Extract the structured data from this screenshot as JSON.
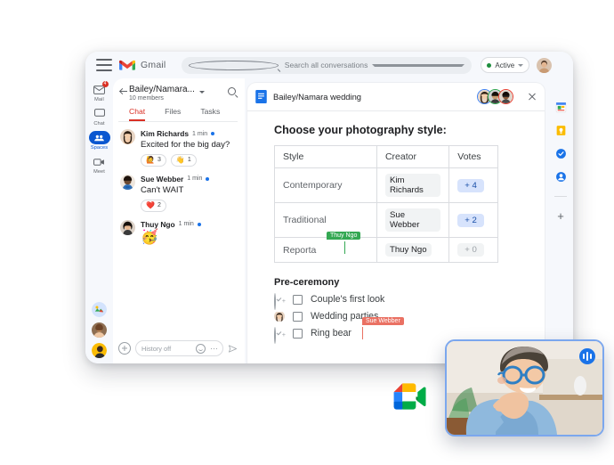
{
  "app": {
    "brand": "Gmail",
    "menu_icon": "hamburger-icon",
    "search": {
      "placeholder": "Search all conversations",
      "value": ""
    },
    "status": {
      "label": "Active",
      "color": "#1e8e3e"
    }
  },
  "left_rail": {
    "items": [
      {
        "label": "Mail",
        "icon": "mail-icon",
        "badge": "4",
        "active": false
      },
      {
        "label": "Chat",
        "icon": "chat-icon",
        "badge": "",
        "active": false
      },
      {
        "label": "Spaces",
        "icon": "spaces-icon",
        "badge": "",
        "active": true
      },
      {
        "label": "Meet",
        "icon": "meet-icon",
        "badge": "",
        "active": false
      }
    ]
  },
  "space": {
    "title": "Bailey/Namara...",
    "members": "10 members",
    "tabs": [
      {
        "label": "Chat",
        "active": true
      },
      {
        "label": "Files",
        "active": false
      },
      {
        "label": "Tasks",
        "active": false
      }
    ],
    "messages": [
      {
        "author": "Kim Richards",
        "time": "1 min",
        "text": "Excited for the big day?",
        "emoji": "",
        "reactions": [
          {
            "emoji": "🙋",
            "count": "3"
          },
          {
            "emoji": "👋",
            "count": "1"
          }
        ]
      },
      {
        "author": "Sue Webber",
        "time": "1 min",
        "text": "Can't WAIT",
        "emoji": "",
        "reactions": [
          {
            "emoji": "❤️",
            "count": "2"
          }
        ]
      },
      {
        "author": "Thuy Ngo",
        "time": "1 min",
        "text": "",
        "emoji": "🥳",
        "reactions": []
      }
    ],
    "composer": {
      "placeholder": "History off",
      "value": "",
      "add_icon": "plus-circle-icon",
      "emoji_icon": "emoji-icon",
      "more_icon": "more-horizontal-icon",
      "send_icon": "send-icon"
    }
  },
  "document": {
    "icon": "google-docs-icon",
    "title": "Bailey/Namara wedding",
    "close_label": "×",
    "collaborators": [
      {
        "name": "collaborator-1",
        "ring": "#4285f4"
      },
      {
        "name": "collaborator-2",
        "ring": "#34a853"
      },
      {
        "name": "collaborator-3",
        "ring": "#ea4335"
      }
    ],
    "question": "Choose your photography style:",
    "table": {
      "headers": [
        "Style",
        "Creator",
        "Votes"
      ],
      "rows": [
        {
          "style": "Contemporary",
          "creator": "Kim Richards",
          "votes": "+ 4",
          "votes_zero": false
        },
        {
          "style": "Traditional",
          "creator": "Sue Webber",
          "votes": "+ 2",
          "votes_zero": false
        },
        {
          "style": "Reporta",
          "creator": "Thuy Ngo",
          "votes": "+ 0",
          "votes_zero": true
        }
      ]
    },
    "cursors": [
      {
        "label": "Thuy Ngo",
        "color": "#34a853"
      },
      {
        "label": "Sue Webber",
        "color": "#ea7163"
      }
    ],
    "section_title": "Pre-ceremony",
    "checklist": [
      {
        "label": "Couple's first look",
        "assignee_icon": "assign-person-icon",
        "checked": false
      },
      {
        "label": "Wedding parties",
        "assignee_icon": "assignee-avatar",
        "checked": false
      },
      {
        "label": "Ring bear",
        "assignee_icon": "assign-person-icon",
        "checked": false
      }
    ]
  },
  "right_rail": {
    "items": [
      {
        "label": "Calendar",
        "icon": "google-calendar-icon"
      },
      {
        "label": "Keep",
        "icon": "google-keep-icon"
      },
      {
        "label": "Tasks",
        "icon": "google-tasks-icon"
      },
      {
        "label": "Contacts",
        "icon": "google-contacts-icon"
      }
    ],
    "add_label": "+"
  },
  "meet": {
    "logo_icon": "google-meet-icon",
    "video_tile": {
      "participant_alt": "smiling older woman with blue glasses",
      "audio_badge_icon": "audio-level-icon",
      "border_color": "#7ba7ee"
    }
  }
}
